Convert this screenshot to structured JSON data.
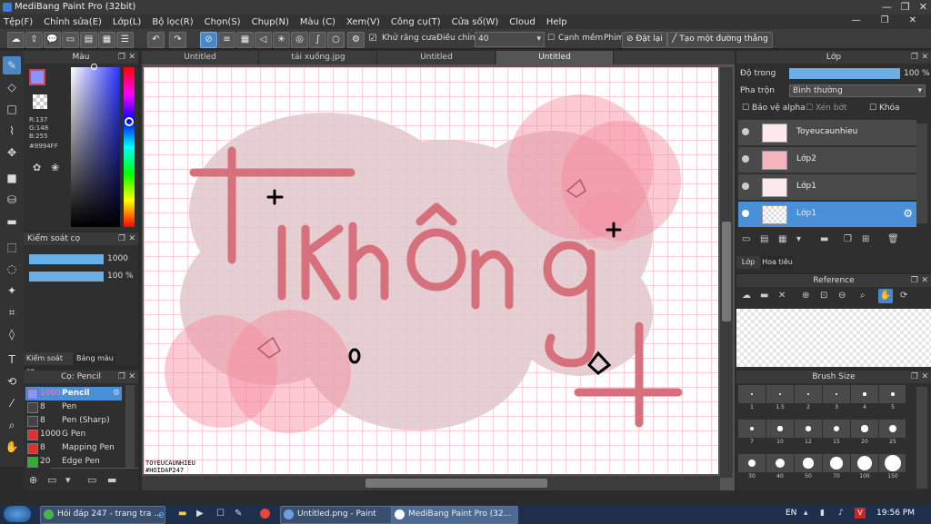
{
  "window": {
    "title": "MediBang Paint Pro (32bit)"
  },
  "menu": [
    "Tệp(F)",
    "Chỉnh sửa(E)",
    "Lớp(L)",
    "Bộ lọc(R)",
    "Chọn(S)",
    "Chụp(N)",
    "Màu (C)",
    "Xem(V)",
    "Công cụ(T)",
    "Cửa số(W)",
    "Cloud",
    "Help"
  ],
  "toolbar": {
    "antialias_label": "Khử răng cưa",
    "adjust_label": "Điều chỉnh",
    "adjust_value": "40",
    "smooth_label": "Cạnh mềm",
    "film_label": "Phim",
    "reset_label": "Đặt lại",
    "straight_label": "Tạo một đường thẳng"
  },
  "tabs": [
    "Untitled",
    "tải xuống.jpg",
    "Untitled",
    "Untitled"
  ],
  "color_panel": {
    "title": "Màu",
    "r": "R:137",
    "g": "G:148",
    "b": "B:255",
    "hex": "#8994FF",
    "current_color": "#8994ff"
  },
  "brush_control": {
    "title": "Kiểm soát cọ",
    "size": "1000",
    "opacity": "100 %",
    "tab1": "Kiểm soát cọ",
    "tab2": "Bảng màu"
  },
  "brush_list": {
    "title": "Cọ: Pencil",
    "items": [
      {
        "size": "1000",
        "name": "Pencil",
        "color": "#8994ff"
      },
      {
        "size": "8",
        "name": "Pen",
        "color": "#444444"
      },
      {
        "size": "8",
        "name": "Pen (Sharp)",
        "color": "#444444"
      },
      {
        "size": "1000",
        "name": "G Pen",
        "color": "#e03030"
      },
      {
        "size": "8",
        "name": "Mapping Pen",
        "color": "#e03030"
      },
      {
        "size": "20",
        "name": "Edge Pen",
        "color": "#30b030"
      }
    ]
  },
  "canvas": {
    "text": "Không",
    "signature_line1": "TOYEUCAUNHIEU",
    "signature_line2": "#HOIDAP247"
  },
  "layer_panel": {
    "title": "Lớp",
    "opacity_label": "Độ trong",
    "opacity_value": "100 %",
    "blend_label": "Pha trộn",
    "blend_value": "Bình thường",
    "protect_alpha": "Bảo vệ alpha",
    "clipping": "Xén bớt",
    "lock": "Khóa",
    "layers": [
      "Toyeucaunhieu",
      "Lớp2",
      "Lớp1",
      "Lớp1"
    ],
    "tab1": "Lớp",
    "tab2": "Hoa tiêu"
  },
  "reference_panel": {
    "title": "Reference"
  },
  "brush_size_panel": {
    "title": "Brush Size",
    "sizes": [
      "1",
      "1.5",
      "2",
      "3",
      "4",
      "5",
      "7",
      "10",
      "12",
      "15",
      "20",
      "25",
      "30",
      "40",
      "50",
      "70",
      "100",
      "150"
    ]
  },
  "taskbar": {
    "items": [
      "Hỏi đáp 247 - trang tra ...",
      "Untitled.png - Paint",
      "MediBang Paint Pro (32..."
    ],
    "lang": "EN",
    "time": "19:56 PM"
  }
}
